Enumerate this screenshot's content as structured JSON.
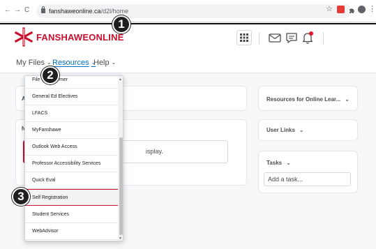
{
  "browser": {
    "url_host": "fanshaweonline.ca",
    "url_path": "/d2l/home"
  },
  "header": {
    "brand_name": "FANSHAWEONLINE",
    "brand_color": "#c8102e"
  },
  "nav": {
    "items": [
      {
        "label": "My Files"
      },
      {
        "label": "Resources"
      },
      {
        "label": "Help"
      }
    ]
  },
  "resources_menu": {
    "items": [
      {
        "label": "File Transformer"
      },
      {
        "label": "General Ed Electives"
      },
      {
        "label": "LFACS"
      },
      {
        "label": "MyFanshawe"
      },
      {
        "label": "Outlook Web Access"
      },
      {
        "label": "Professor Accessibility Services"
      },
      {
        "label": "Quick Eval"
      },
      {
        "label": "Self Registration"
      },
      {
        "label": "Student Services"
      },
      {
        "label": "WebAdvisor"
      }
    ],
    "highlighted": "Self Registration"
  },
  "widgets": {
    "announcements_title_fragment": "A",
    "news_title_fragment": "N",
    "nothing_to_display_fragment": "isplay.",
    "resources_online": "Resources for Online Lear...",
    "user_links": "User Links",
    "tasks": "Tasks",
    "add_task_placeholder": "Add a task..."
  },
  "callouts": [
    "1",
    "2",
    "3"
  ],
  "icons": [
    "back-icon",
    "forward-icon",
    "reload-icon",
    "lock-icon",
    "star-icon",
    "extension-icon",
    "profile-icon",
    "menu-icon",
    "fanshawe-logo-icon",
    "apps-grid-icon",
    "message-icon",
    "chat-icon",
    "bell-icon",
    "chevron-down-icon"
  ]
}
